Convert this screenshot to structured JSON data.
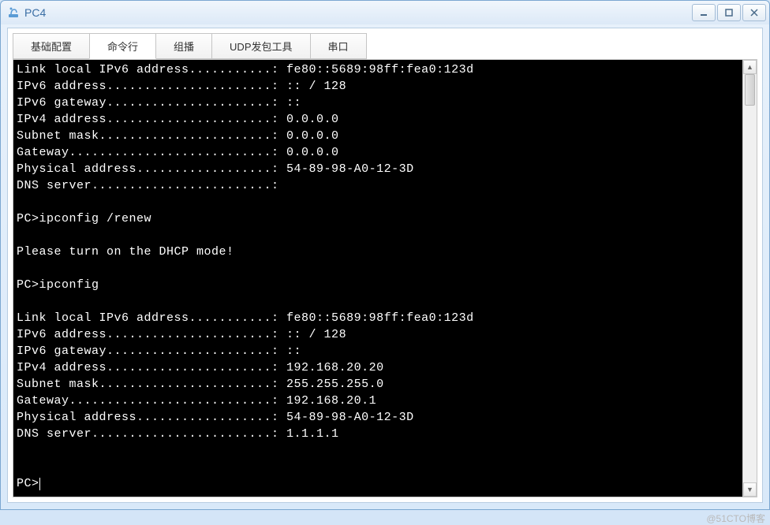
{
  "window": {
    "title": "PC4"
  },
  "tabs": [
    {
      "label": "基础配置",
      "active": false
    },
    {
      "label": "命令行",
      "active": true
    },
    {
      "label": "组播",
      "active": false
    },
    {
      "label": "UDP发包工具",
      "active": false
    },
    {
      "label": "串口",
      "active": false
    }
  ],
  "terminal": {
    "lines": [
      "Link local IPv6 address...........: fe80::5689:98ff:fea0:123d",
      "IPv6 address......................: :: / 128",
      "IPv6 gateway......................: ::",
      "IPv4 address......................: 0.0.0.0",
      "Subnet mask.......................: 0.0.0.0",
      "Gateway...........................: 0.0.0.0",
      "Physical address..................: 54-89-98-A0-12-3D",
      "DNS server........................:",
      "",
      "PC>ipconfig /renew",
      "",
      "Please turn on the DHCP mode!",
      "",
      "PC>ipconfig",
      "",
      "Link local IPv6 address...........: fe80::5689:98ff:fea0:123d",
      "IPv6 address......................: :: / 128",
      "IPv6 gateway......................: ::",
      "IPv4 address......................: 192.168.20.20",
      "Subnet mask.......................: 255.255.255.0",
      "Gateway...........................: 192.168.20.1",
      "Physical address..................: 54-89-98-A0-12-3D",
      "DNS server........................: 1.1.1.1",
      "",
      ""
    ],
    "prompt": "PC>"
  },
  "watermark": "@51CTO博客"
}
